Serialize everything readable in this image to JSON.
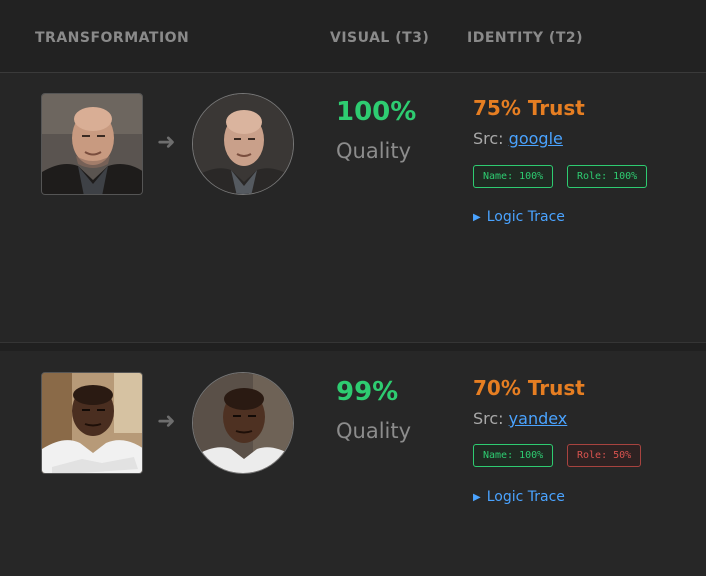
{
  "header": {
    "col_transformation": "TRANSFORMATION",
    "col_visual": "VISUAL (T3)",
    "col_identity": "IDENTITY (T2)"
  },
  "rows": [
    {
      "arrow": "➜",
      "visual_pct": "100%",
      "visual_label": "Quality",
      "trust": "75% Trust",
      "src_prefix": "Src:",
      "src_link": "google",
      "badge_name": "Name: 100%",
      "badge_role": "Role: 100%",
      "badge_role_status": "ok",
      "trace": "Logic Trace",
      "trace_icon": "triangle-right-icon"
    },
    {
      "arrow": "➜",
      "visual_pct": "99%",
      "visual_label": "Quality",
      "trust": "70% Trust",
      "src_prefix": "Src:",
      "src_link": "yandex",
      "badge_name": "Name: 100%",
      "badge_role": "Role: 50%",
      "badge_role_status": "bad",
      "trace": "Logic Trace",
      "trace_icon": "triangle-right-icon"
    }
  ],
  "colors": {
    "visual_green": "#2ecc71",
    "trust_orange": "#e67e22",
    "link_blue": "#4aa3ff",
    "badge_red": "#d9534f"
  }
}
